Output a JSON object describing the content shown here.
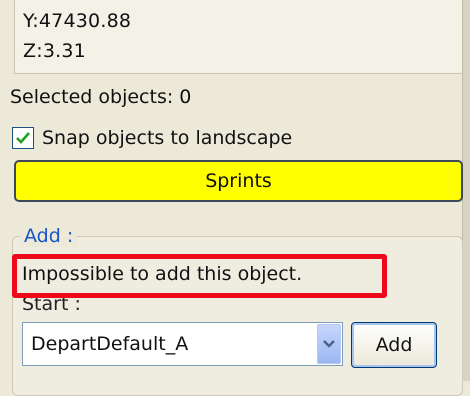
{
  "coordinates": {
    "y": "Y:47430.88",
    "z": "Z:3.31"
  },
  "selected_objects": "Selected objects: 0",
  "snap": {
    "label": "Snap objects to landscape",
    "checked": true
  },
  "sprints_button": {
    "label": "Sprints",
    "color": "#ffff00"
  },
  "add_section": {
    "legend": "Add :",
    "error_message": "Impossible to add this object.",
    "highlight_color": "#ee0a1a",
    "start_label": "Start :",
    "start_select": {
      "value": "DepartDefault_A"
    },
    "add_button": "Add"
  },
  "accent_color": "#1a55c8"
}
